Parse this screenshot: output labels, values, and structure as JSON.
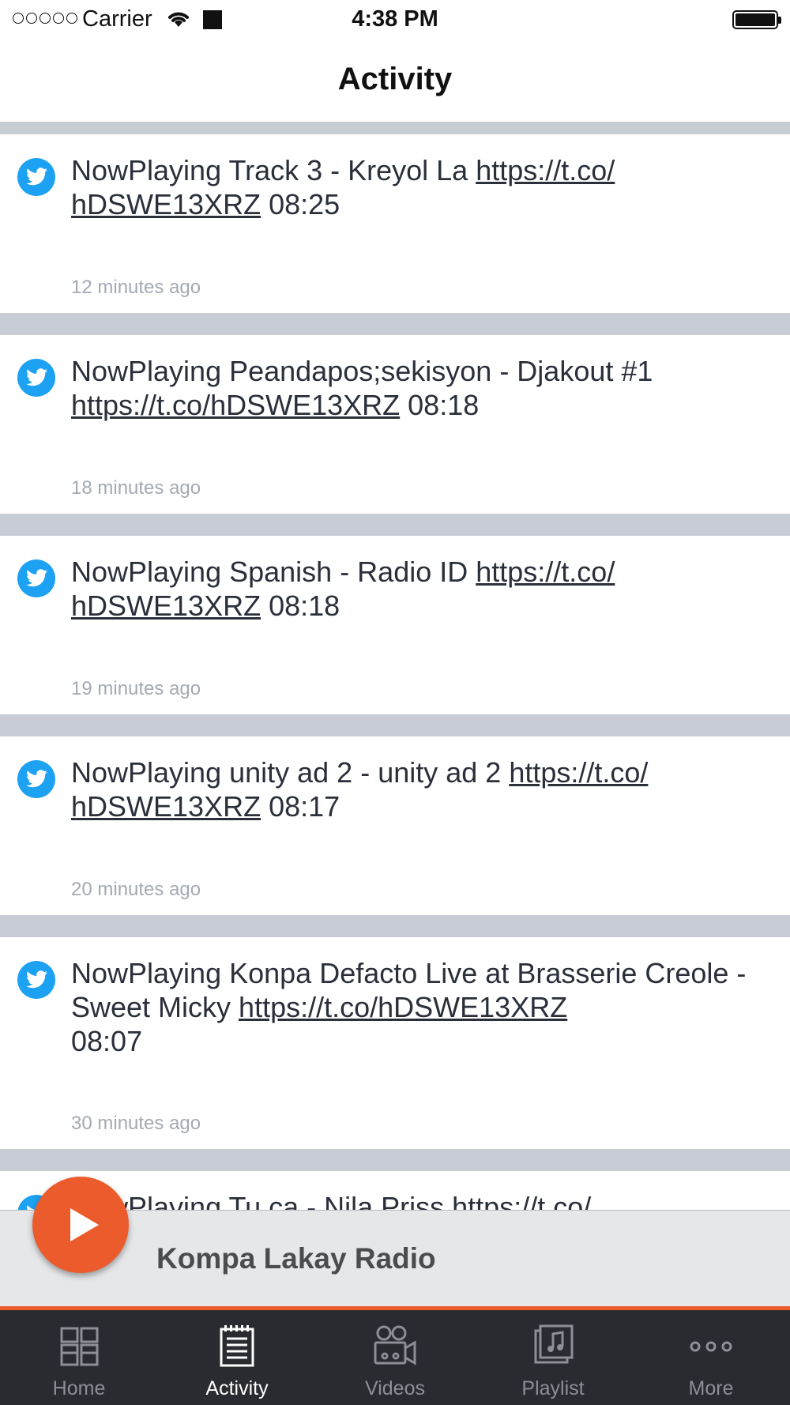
{
  "status_bar": {
    "carrier": "Carrier",
    "time": "4:38 PM",
    "icons": [
      "signal-dots-icon",
      "wifi-icon",
      "square-icon",
      "battery-icon"
    ]
  },
  "header": {
    "title": "Activity"
  },
  "feed": {
    "items": [
      {
        "text": "NowPlaying Track 3 - Kreyol La ",
        "link": "https://t.co/hDSWE13XRZ",
        "link_part1": "https://t.co/",
        "link_part2": "hDSWE13XRZ",
        "suffix": " 08:25",
        "time": "12 minutes ago",
        "icon": "twitter-icon"
      },
      {
        "text": "NowPlaying Peandapos;sekisyon - Djakout #1",
        "link": "https://t.co/hDSWE13XRZ",
        "suffix": " 08:18",
        "time": "18 minutes ago",
        "icon": "twitter-icon"
      },
      {
        "text": "NowPlaying Spanish - Radio ID ",
        "link": "https://t.co/hDSWE13XRZ",
        "link_part1": "https://t.co/",
        "link_part2": "hDSWE13XRZ",
        "suffix": " 08:18",
        "time": "19 minutes ago",
        "icon": "twitter-icon"
      },
      {
        "text": "NowPlaying unity ad 2 - unity ad 2 ",
        "link": "https://t.co/hDSWE13XRZ",
        "link_part1": "https://t.co/",
        "link_part2": "hDSWE13XRZ",
        "suffix": " 08:17",
        "time": "20 minutes ago",
        "icon": "twitter-icon"
      },
      {
        "text": "NowPlaying Konpa Defacto Live at Brasserie Creole - Sweet Micky ",
        "link": "https://t.co/hDSWE13XRZ",
        "suffix": "08:07",
        "time": "30 minutes ago",
        "icon": "twitter-icon"
      },
      {
        "text": "NowPlaying Tu ca - Nila Priss ",
        "link_part1": "https://t.co/",
        "icon": "twitter-icon"
      }
    ]
  },
  "player": {
    "station": "Kompa Lakay Radio",
    "play_icon": "play-icon",
    "accent": "#ec5b2c"
  },
  "tabs": [
    {
      "label": "Home",
      "icon": "home-grid-icon",
      "active": false
    },
    {
      "label": "Activity",
      "icon": "activity-notepad-icon",
      "active": true
    },
    {
      "label": "Videos",
      "icon": "video-camera-icon",
      "active": false
    },
    {
      "label": "Playlist",
      "icon": "playlist-music-icon",
      "active": false
    },
    {
      "label": "More",
      "icon": "more-dots-icon",
      "active": false
    }
  ],
  "colors": {
    "tab_bar": "#2a2a31",
    "separator": "#c8ccd4",
    "twitter": "#1da1f2",
    "timestamp": "#a4a9b3"
  }
}
